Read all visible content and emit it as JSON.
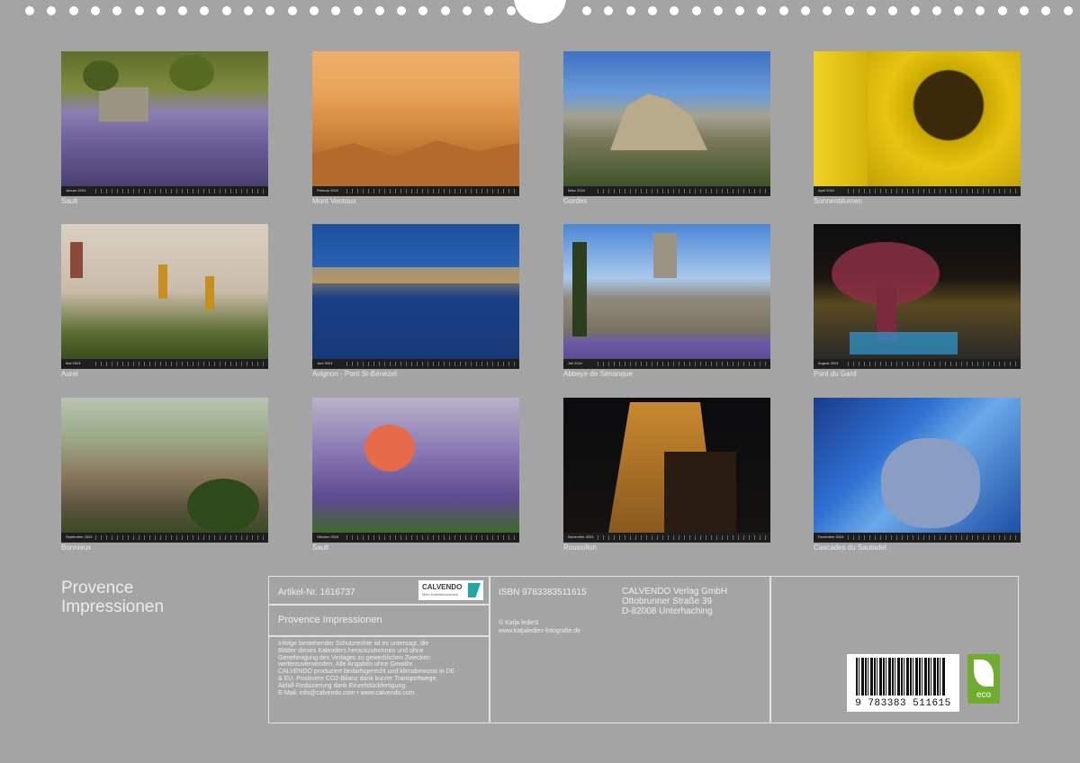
{
  "binding": {
    "hole_count": 46
  },
  "months": [
    {
      "name": "Januar 2024",
      "caption": "Sault"
    },
    {
      "name": "Februar 2024",
      "caption": "Mont Ventoux"
    },
    {
      "name": "März 2024",
      "caption": "Gordes"
    },
    {
      "name": "April 2024",
      "caption": "Sonnenblumen"
    },
    {
      "name": "Mai 2024",
      "caption": "Aurel"
    },
    {
      "name": "Juni 2024",
      "caption": "Avignon - Pont St-Bénézet"
    },
    {
      "name": "Juli 2024",
      "caption": "Abbeye de Sénanque"
    },
    {
      "name": "August 2024",
      "caption": "Pont du Gard"
    },
    {
      "name": "September 2024",
      "caption": "Bonnieux"
    },
    {
      "name": "Oktober 2024",
      "caption": "Sault"
    },
    {
      "name": "November 2024",
      "caption": "Roussillon"
    },
    {
      "name": "Dezember 2024",
      "caption": "Cascades du Sautadet"
    }
  ],
  "title": {
    "line1": "Provence",
    "line2": "Impressionen"
  },
  "info": {
    "article": "Artikel-Nr. 1616737",
    "logo_name": "CALVENDO",
    "logo_tagline": "Mein Kalendermoment",
    "calendar_title": "Provence Impressionen",
    "legal": "Infolge bestehender Schutzrechte ist es untersagt, die\nBlätter dieses Kalenders herauszutrennen und ohne\nGenehmigung des Verlages zu gewerblichen Zwecken\nweiterzuverwenden. Alle Angaben ohne Gewähr.\nCALVENDO produziert bedarfsgerecht und klimabewusst in DE\n& EU. Positivere CO2-Bilanz dank kurzer Transportwege,\nAbfall-Reduzierung dank Einzelstückfertigung.\nE-Mail: info@calvendo.com • www.calvendo.com",
    "isbn": "ISBN 9783383511615",
    "copyright": "© Katja ledieS\nwww.katjaledies-fotografie.de",
    "publisher": "CALVENDO Verlag GmbH\nOttobrunner Straße 39\nD-82008 Unterhaching",
    "barcode_number": "9 783383 511615",
    "eco_label": "eco"
  },
  "colors": {
    "background": "#a4a4a4",
    "eco": "#6fad2f"
  }
}
